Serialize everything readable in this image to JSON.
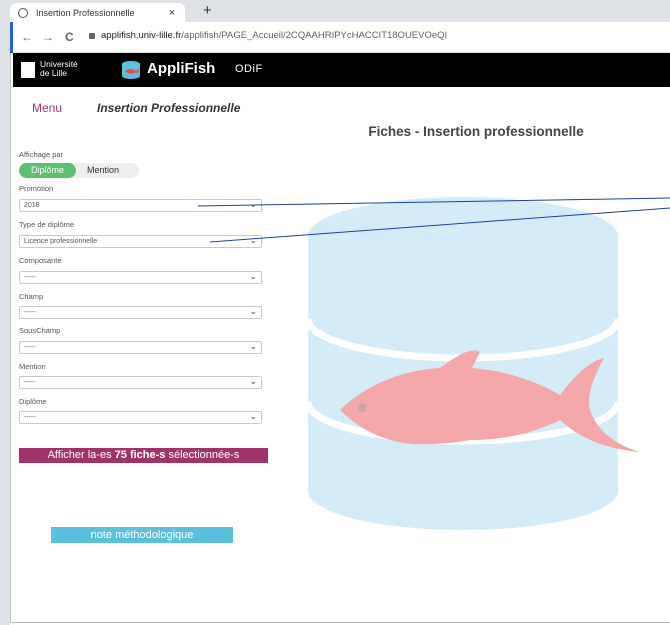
{
  "browser": {
    "tab_title": "Insertion Professionnelle",
    "close_glyph": "×",
    "new_tab_glyph": "+",
    "back_glyph": "←",
    "forward_glyph": "→",
    "reload_glyph": "C",
    "url_host": "applifish.univ-lille.fr",
    "url_path": "/applifish/PAGE_Accueil/2CQAAHRIPYcHACCIT18OUEVOeQI"
  },
  "header": {
    "university_line1": "Université",
    "university_line2": "de Lille",
    "app_name": "AppliFish",
    "odif": "ODiF"
  },
  "nav": {
    "menu": "Menu",
    "breadcrumb": "Insertion Professionnelle"
  },
  "main": {
    "title": "Fiches - Insertion professionnelle"
  },
  "filters": {
    "display_label": "Affichage par",
    "toggle_on": "Diplôme",
    "toggle_off": "Mention",
    "promotion_label": "Promotion",
    "promotion_value": "2018",
    "type_label": "Type de diplôme",
    "type_value": "Licence professionnelle",
    "composante_label": "Composante",
    "composante_value": "-----",
    "champ_label": "Champ",
    "champ_value": "-----",
    "souschamp_label": "SousChamp",
    "souschamp_value": "-----",
    "mention_label": "Mention",
    "mention_value": "-----",
    "diplome_label": "Diplôme",
    "diplome_value": "-----",
    "chevron": "⌄"
  },
  "actions": {
    "show_prefix": "Afficher la-es ",
    "show_count": "75 fiche-s",
    "show_suffix": " sélectionnée-s",
    "note": "note méthodologique"
  },
  "icons": {
    "tab_favicon": "globe-icon",
    "lock": "lock-icon",
    "logo": "database-icon",
    "watermark": "database-fish-watermark"
  },
  "colors": {
    "accent": "#a0336a",
    "toggle_green": "#5cc072",
    "note_blue": "#5bc0de",
    "watermark_db": "#d3ecf8",
    "watermark_fish": "#f3a7a9"
  }
}
